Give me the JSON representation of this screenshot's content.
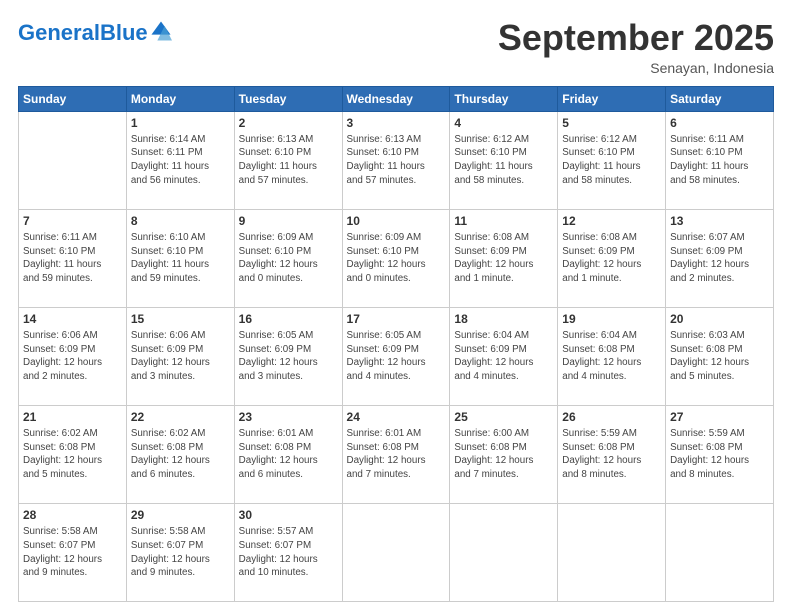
{
  "header": {
    "logo_general": "General",
    "logo_blue": "Blue",
    "month_year": "September 2025",
    "location": "Senayan, Indonesia"
  },
  "days_of_week": [
    "Sunday",
    "Monday",
    "Tuesday",
    "Wednesday",
    "Thursday",
    "Friday",
    "Saturday"
  ],
  "weeks": [
    [
      {
        "day": "",
        "info": ""
      },
      {
        "day": "1",
        "info": "Sunrise: 6:14 AM\nSunset: 6:11 PM\nDaylight: 11 hours\nand 56 minutes."
      },
      {
        "day": "2",
        "info": "Sunrise: 6:13 AM\nSunset: 6:10 PM\nDaylight: 11 hours\nand 57 minutes."
      },
      {
        "day": "3",
        "info": "Sunrise: 6:13 AM\nSunset: 6:10 PM\nDaylight: 11 hours\nand 57 minutes."
      },
      {
        "day": "4",
        "info": "Sunrise: 6:12 AM\nSunset: 6:10 PM\nDaylight: 11 hours\nand 58 minutes."
      },
      {
        "day": "5",
        "info": "Sunrise: 6:12 AM\nSunset: 6:10 PM\nDaylight: 11 hours\nand 58 minutes."
      },
      {
        "day": "6",
        "info": "Sunrise: 6:11 AM\nSunset: 6:10 PM\nDaylight: 11 hours\nand 58 minutes."
      }
    ],
    [
      {
        "day": "7",
        "info": "Sunrise: 6:11 AM\nSunset: 6:10 PM\nDaylight: 11 hours\nand 59 minutes."
      },
      {
        "day": "8",
        "info": "Sunrise: 6:10 AM\nSunset: 6:10 PM\nDaylight: 11 hours\nand 59 minutes."
      },
      {
        "day": "9",
        "info": "Sunrise: 6:09 AM\nSunset: 6:10 PM\nDaylight: 12 hours\nand 0 minutes."
      },
      {
        "day": "10",
        "info": "Sunrise: 6:09 AM\nSunset: 6:10 PM\nDaylight: 12 hours\nand 0 minutes."
      },
      {
        "day": "11",
        "info": "Sunrise: 6:08 AM\nSunset: 6:09 PM\nDaylight: 12 hours\nand 1 minute."
      },
      {
        "day": "12",
        "info": "Sunrise: 6:08 AM\nSunset: 6:09 PM\nDaylight: 12 hours\nand 1 minute."
      },
      {
        "day": "13",
        "info": "Sunrise: 6:07 AM\nSunset: 6:09 PM\nDaylight: 12 hours\nand 2 minutes."
      }
    ],
    [
      {
        "day": "14",
        "info": "Sunrise: 6:06 AM\nSunset: 6:09 PM\nDaylight: 12 hours\nand 2 minutes."
      },
      {
        "day": "15",
        "info": "Sunrise: 6:06 AM\nSunset: 6:09 PM\nDaylight: 12 hours\nand 3 minutes."
      },
      {
        "day": "16",
        "info": "Sunrise: 6:05 AM\nSunset: 6:09 PM\nDaylight: 12 hours\nand 3 minutes."
      },
      {
        "day": "17",
        "info": "Sunrise: 6:05 AM\nSunset: 6:09 PM\nDaylight: 12 hours\nand 4 minutes."
      },
      {
        "day": "18",
        "info": "Sunrise: 6:04 AM\nSunset: 6:09 PM\nDaylight: 12 hours\nand 4 minutes."
      },
      {
        "day": "19",
        "info": "Sunrise: 6:04 AM\nSunset: 6:08 PM\nDaylight: 12 hours\nand 4 minutes."
      },
      {
        "day": "20",
        "info": "Sunrise: 6:03 AM\nSunset: 6:08 PM\nDaylight: 12 hours\nand 5 minutes."
      }
    ],
    [
      {
        "day": "21",
        "info": "Sunrise: 6:02 AM\nSunset: 6:08 PM\nDaylight: 12 hours\nand 5 minutes."
      },
      {
        "day": "22",
        "info": "Sunrise: 6:02 AM\nSunset: 6:08 PM\nDaylight: 12 hours\nand 6 minutes."
      },
      {
        "day": "23",
        "info": "Sunrise: 6:01 AM\nSunset: 6:08 PM\nDaylight: 12 hours\nand 6 minutes."
      },
      {
        "day": "24",
        "info": "Sunrise: 6:01 AM\nSunset: 6:08 PM\nDaylight: 12 hours\nand 7 minutes."
      },
      {
        "day": "25",
        "info": "Sunrise: 6:00 AM\nSunset: 6:08 PM\nDaylight: 12 hours\nand 7 minutes."
      },
      {
        "day": "26",
        "info": "Sunrise: 5:59 AM\nSunset: 6:08 PM\nDaylight: 12 hours\nand 8 minutes."
      },
      {
        "day": "27",
        "info": "Sunrise: 5:59 AM\nSunset: 6:08 PM\nDaylight: 12 hours\nand 8 minutes."
      }
    ],
    [
      {
        "day": "28",
        "info": "Sunrise: 5:58 AM\nSunset: 6:07 PM\nDaylight: 12 hours\nand 9 minutes."
      },
      {
        "day": "29",
        "info": "Sunrise: 5:58 AM\nSunset: 6:07 PM\nDaylight: 12 hours\nand 9 minutes."
      },
      {
        "day": "30",
        "info": "Sunrise: 5:57 AM\nSunset: 6:07 PM\nDaylight: 12 hours\nand 10 minutes."
      },
      {
        "day": "",
        "info": ""
      },
      {
        "day": "",
        "info": ""
      },
      {
        "day": "",
        "info": ""
      },
      {
        "day": "",
        "info": ""
      }
    ]
  ]
}
